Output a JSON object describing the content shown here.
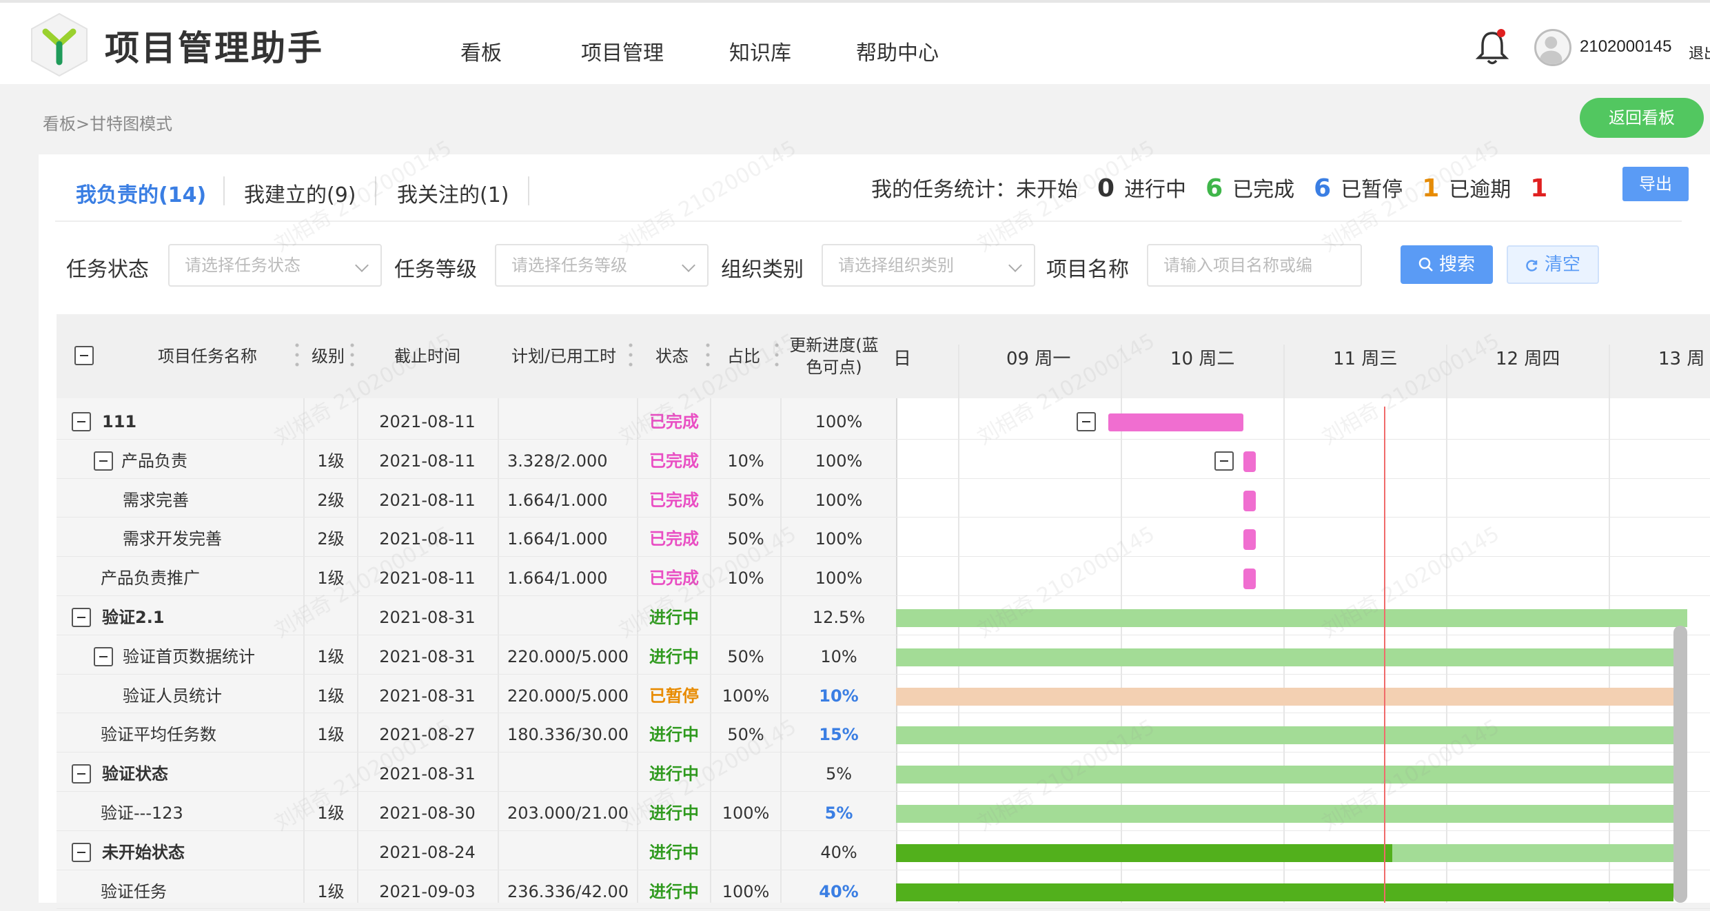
{
  "app": {
    "title": "项目管理助手"
  },
  "nav": {
    "items": [
      "看板",
      "项目管理",
      "知识库",
      "帮助中心"
    ]
  },
  "user": {
    "id": "2102000145",
    "logout": "退出"
  },
  "breadcrumb": "看板>甘特图模式",
  "back_button": "返回看板",
  "tabs": [
    "我负责的(14)",
    "我建立的(9)",
    "我关注的(1)"
  ],
  "stats": {
    "label": "我的任务统计：",
    "not_started_label": "未开始",
    "not_started": "0",
    "in_progress_label": "进行中",
    "in_progress": "6",
    "done_label": "已完成",
    "done": "6",
    "paused_label": "已暂停",
    "paused": "1",
    "overdue_label": "已逾期",
    "overdue": "1"
  },
  "export_button": "导出",
  "filters": {
    "status_label": "任务状态",
    "status_placeholder": "请选择任务状态",
    "level_label": "任务等级",
    "level_placeholder": "请选择任务等级",
    "org_label": "组织类别",
    "org_placeholder": "请选择组织类别",
    "project_label": "项目名称",
    "project_placeholder": "请输入项目名称或编",
    "search_button": "搜索",
    "clear_button": "清空"
  },
  "columns": {
    "name": "项目任务名称",
    "level": "级别",
    "deadline": "截止时间",
    "hours": "计划/已用工时",
    "status": "状态",
    "ratio": "占比",
    "progress": "更新进度(蓝色可点)"
  },
  "gantt_days": [
    "日",
    "09 周一",
    "10 周二",
    "11 周三",
    "12 周四",
    "13 周"
  ],
  "colors": {
    "done": "#e94ec3",
    "doing": "#2f9a1e",
    "paused": "#e88b00",
    "accent": "#3a7ee3",
    "bar_done": "#f06ed0",
    "bar_doing": "#a3dc96",
    "bar_paused": "#f3d0b2",
    "bar_progress": "#52b01c"
  },
  "rows": [
    {
      "name": "111",
      "level": "",
      "deadline": "2021-08-11",
      "hours": "",
      "status": "已完成",
      "ratio": "",
      "progress": "100%"
    },
    {
      "name": "产品负责",
      "level": "1级",
      "deadline": "2021-08-11",
      "hours": "3.328/2.000",
      "status": "已完成",
      "ratio": "10%",
      "progress": "100%"
    },
    {
      "name": "需求完善",
      "level": "2级",
      "deadline": "2021-08-11",
      "hours": "1.664/1.000",
      "status": "已完成",
      "ratio": "50%",
      "progress": "100%"
    },
    {
      "name": "需求开发完善",
      "level": "2级",
      "deadline": "2021-08-11",
      "hours": "1.664/1.000",
      "status": "已完成",
      "ratio": "50%",
      "progress": "100%"
    },
    {
      "name": "产品负责推广",
      "level": "1级",
      "deadline": "2021-08-11",
      "hours": "1.664/1.000",
      "status": "已完成",
      "ratio": "10%",
      "progress": "100%"
    },
    {
      "name": "验证2.1",
      "level": "",
      "deadline": "2021-08-31",
      "hours": "",
      "status": "进行中",
      "ratio": "",
      "progress": "12.5%"
    },
    {
      "name": "验证首页数据统计",
      "level": "1级",
      "deadline": "2021-08-31",
      "hours": "220.000/5.000",
      "status": "进行中",
      "ratio": "50%",
      "progress": "10%"
    },
    {
      "name": "验证人员统计",
      "level": "1级",
      "deadline": "2021-08-31",
      "hours": "220.000/5.000",
      "status": "已暂停",
      "ratio": "100%",
      "progress": "10%"
    },
    {
      "name": "验证平均任务数",
      "level": "1级",
      "deadline": "2021-08-27",
      "hours": "180.336/30.00",
      "status": "进行中",
      "ratio": "50%",
      "progress": "15%"
    },
    {
      "name": "验证状态",
      "level": "",
      "deadline": "2021-08-31",
      "hours": "",
      "status": "进行中",
      "ratio": "",
      "progress": "5%"
    },
    {
      "name": "验证---123",
      "level": "1级",
      "deadline": "2021-08-30",
      "hours": "203.000/21.00",
      "status": "进行中",
      "ratio": "100%",
      "progress": "5%"
    },
    {
      "name": "未开始状态",
      "level": "",
      "deadline": "2021-08-24",
      "hours": "",
      "status": "进行中",
      "ratio": "",
      "progress": "40%"
    },
    {
      "name": "验证任务",
      "level": "1级",
      "deadline": "2021-09-03",
      "hours": "236.336/42.00",
      "status": "进行中",
      "ratio": "100%",
      "progress": "40%"
    }
  ],
  "watermark": "刘相奇 2102000145"
}
